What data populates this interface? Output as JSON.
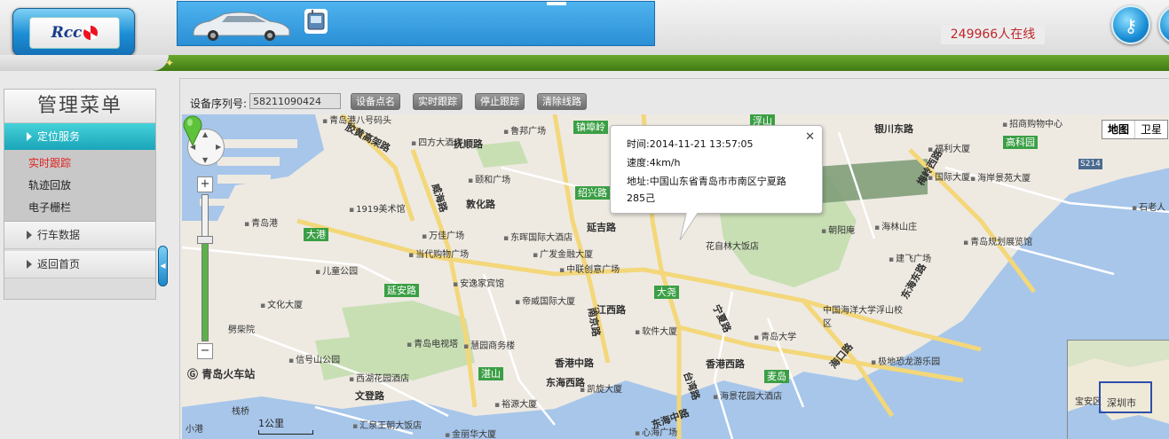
{
  "header": {
    "logo_text": "Rcc",
    "online_count": "249966人在线"
  },
  "sidebar": {
    "title": "管理菜单",
    "groups": [
      {
        "label": "定位服务",
        "active": true,
        "subitems": [
          {
            "label": "实时跟踪",
            "current": true
          },
          {
            "label": "轨迹回放"
          },
          {
            "label": "电子栅栏"
          }
        ]
      },
      {
        "label": "行车数据"
      },
      {
        "label": "返回首页"
      }
    ]
  },
  "toolbar": {
    "serial_label": "设备序列号:",
    "serial_value": "58211090424",
    "buttons": {
      "locate": "设备点名",
      "track": "实时跟踪",
      "stop": "停止跟踪",
      "clear": "清除线路"
    }
  },
  "map": {
    "type_map": "地图",
    "type_satellite": "卫星",
    "scale_label": "1公里",
    "train_station": "青岛火车站",
    "info": {
      "time": "时间:2014-11-21 13:57:05",
      "speed": "速度:4km/h",
      "address_line1": "地址:中国山东省青岛市市南区宁夏路",
      "address_line2": "285己"
    },
    "overview_labels": {
      "bao_an": "宝安区",
      "shenzhen": "深圳市"
    },
    "poi": [
      "青岛港八号码头",
      "四方大酒店",
      "鲁邦广场",
      "颐和广场",
      "万佳广场",
      "1919美术馆",
      "青岛港",
      "东晖国际大酒店",
      "当代购物广场",
      "广发金融大厦",
      "中联创意广场",
      "儿童公园",
      "安逸家宾馆",
      "文化大厦",
      "帝威国际大厦",
      "劈柴院",
      "软件大厦",
      "青岛电视塔",
      "慧园商务楼",
      "信号山公园",
      "青岛大学",
      "西湖花园酒店",
      "凯旋大厦",
      "裕源大厦",
      "汇泉王朝大饭店",
      "金丽华大厦",
      "心海广场",
      "花自林大饭店",
      "朝阳庵",
      "海林山庄",
      "建飞广场",
      "中国海洋大学浮山校区",
      "极地恐龙游乐园",
      "海景花园大酒店",
      "青岛规划展览馆",
      "海岸景苑大厦",
      "国际大厦",
      "福利大厦",
      "招商购物中心",
      "石老人",
      "栈桥",
      "小港"
    ],
    "roads": [
      "抚顺路",
      "胶黄高架路",
      "威海路",
      "敦化路",
      "延吉路",
      "江西路",
      "南京路",
      "香港中路",
      "东海西路",
      "宁夏路",
      "台湾路",
      "海口路",
      "东海中路",
      "东海东路",
      "银川东路",
      "香港西路",
      "梅岭西路",
      "文登路"
    ],
    "green_tags": [
      "镇埠岭",
      "浮山",
      "绍兴路",
      "高科园",
      "大港",
      "延安路",
      "大尧",
      "湛山",
      "麦岛"
    ],
    "highway_tag": "S214"
  }
}
